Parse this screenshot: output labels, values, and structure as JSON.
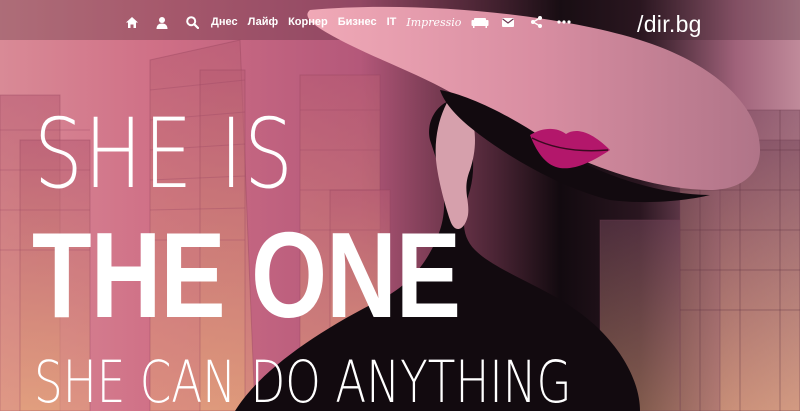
{
  "nav": {
    "home_icon": "home-icon",
    "user_icon": "user-icon",
    "search_icon": "search-icon",
    "links": [
      "Днес",
      "Лайф",
      "Корнер",
      "Бизнес",
      "IT"
    ],
    "impressio_label": "Impressio",
    "sofa_icon": "sofa-icon",
    "mail_icon": "envelope-icon",
    "share_icon": "share-icon",
    "more_icon": "more-dots-icon"
  },
  "logo": {
    "text": "/dir.bg"
  },
  "hero": {
    "line1": "SHE IS",
    "line2": "THE ONE",
    "line3": "SHE CAN DO ANYTHING"
  },
  "colors": {
    "pink": "#cf6f86",
    "dark": "#120a0f",
    "lips": "#b3176b",
    "hat_brim": "#d48d9f",
    "text": "#ffffff"
  }
}
